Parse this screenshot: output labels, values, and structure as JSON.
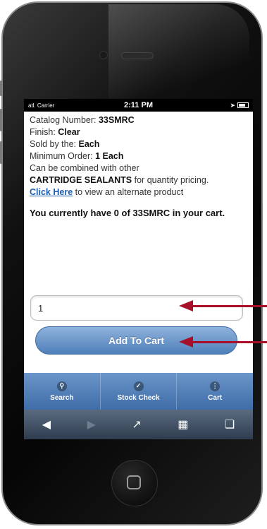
{
  "statusbar": {
    "carrier": "atl. Carrier",
    "time": "2:11 PM"
  },
  "product": {
    "catalog_label": "Catalog Number: ",
    "catalog_value": "33SMRC",
    "finish_label": "Finish: ",
    "finish_value": "Clear",
    "sold_label": "Sold by the: ",
    "sold_value": "Each",
    "min_label": "Minimum Order: ",
    "min_value": "1 Each",
    "combine_text": "Can be combined with other",
    "combine_bold": "CARTRIDGE SEALANTS",
    "combine_rest": " for quantity pricing.",
    "link_text": "Click Here",
    "link_rest": " to view an alternate product"
  },
  "cart": {
    "status": "You currently have 0 of 33SMRC in your cart.",
    "quantity_value": "1",
    "add_button": "Add To Cart"
  },
  "nav": {
    "items": [
      {
        "label": "Search",
        "icon": "search-icon"
      },
      {
        "label": "Stock Check",
        "icon": "check-icon"
      },
      {
        "label": "Cart",
        "icon": "grid-icon"
      }
    ]
  },
  "colors": {
    "accent": "#4f7fba",
    "arrow": "#a8102a",
    "link": "#1a5fb4"
  }
}
